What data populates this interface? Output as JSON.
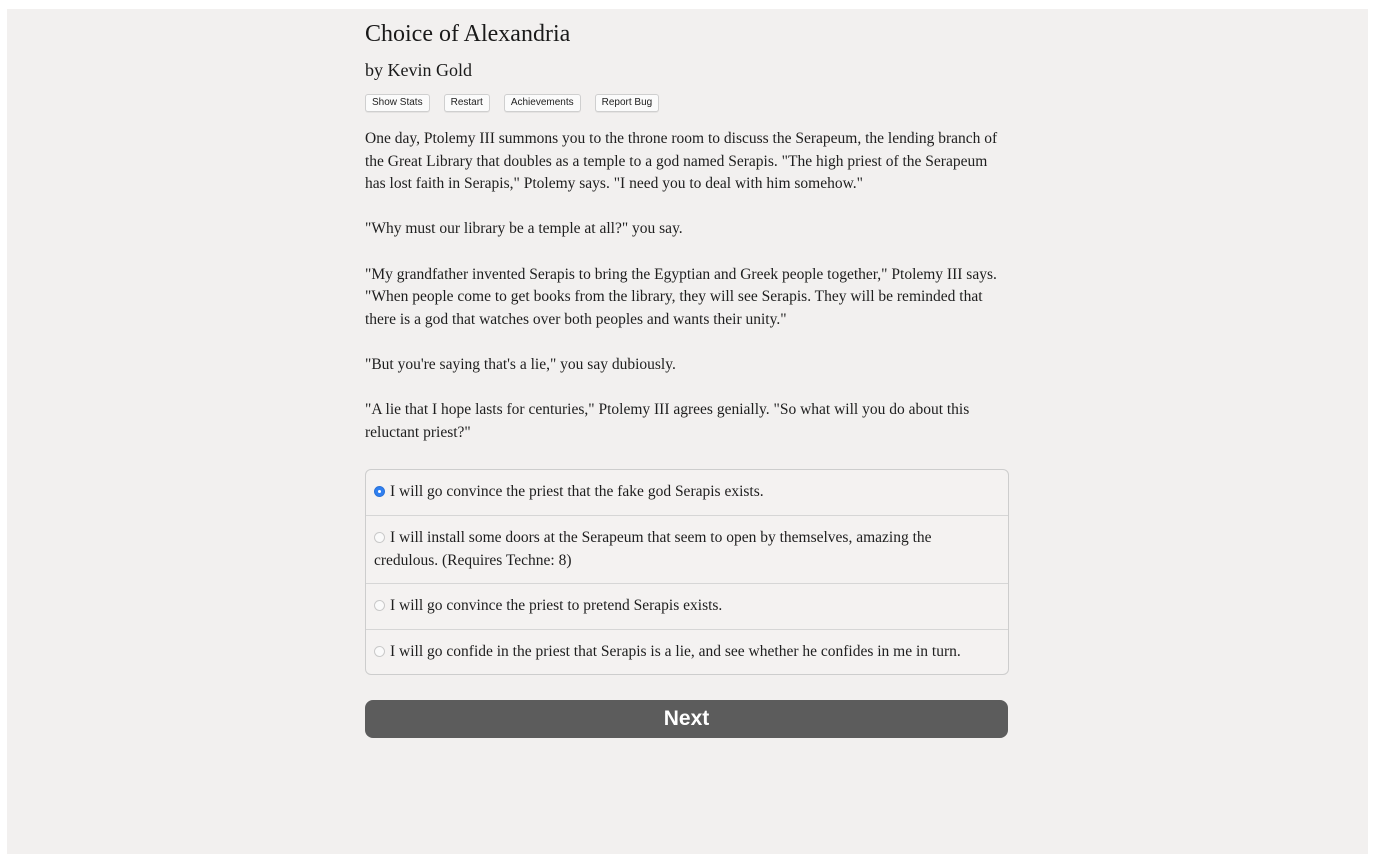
{
  "game": {
    "title": "Choice of Alexandria",
    "byline": "by Kevin Gold"
  },
  "toolbar": {
    "show_stats": "Show Stats",
    "restart": "Restart",
    "achievements": "Achievements",
    "report_bug": "Report Bug"
  },
  "story": {
    "paragraphs": [
      "One day, Ptolemy III summons you to the throne room to discuss the Serapeum, the lending branch of the Great Library that doubles as a temple to a god named Serapis. \"The high priest of the Serapeum has lost faith in Serapis,\" Ptolemy says. \"I need you to deal with him somehow.\"",
      "\"Why must our library be a temple at all?\" you say.",
      "\"My grandfather invented Serapis to bring the Egyptian and Greek people together,\" Ptolemy III says. \"When people come to get books from the library, they will see Serapis. They will be reminded that there is a god that watches over both peoples and wants their unity.\"",
      "\"But you're saying that's a lie,\" you say dubiously.",
      "\"A lie that I hope lasts for centuries,\" Ptolemy III agrees genially. \"So what will you do about this reluctant priest?\""
    ]
  },
  "choices": [
    {
      "label": "I will go convince the priest that the fake god Serapis exists.",
      "selected": true
    },
    {
      "label": "I will install some doors at the Serapeum that seem to open by themselves, amazing the credulous. (Requires Techne: 8)",
      "selected": false
    },
    {
      "label": "I will go convince the priest to pretend Serapis exists.",
      "selected": false
    },
    {
      "label": "I will go confide in the priest that Serapis is a lie, and see whether he confides in me in turn.",
      "selected": false
    }
  ],
  "next_button": "Next",
  "colors": {
    "background": "#f2f0ef",
    "radio_selected": "#2f7ff0",
    "next_button": "#5c5c5c"
  }
}
